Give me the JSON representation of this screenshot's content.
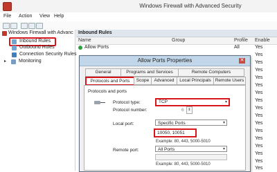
{
  "window": {
    "title": "Windows Firewall with Advanced Security"
  },
  "menu": [
    "File",
    "Action",
    "View",
    "Help"
  ],
  "tree": {
    "root": "Windows Firewall with Advanc",
    "items": [
      "Inbound Rules",
      "Outbound Rules",
      "Connection Security Rules",
      "Monitoring"
    ]
  },
  "pane": {
    "header": "Inbound Rules",
    "columns": {
      "name": "Name",
      "group": "Group",
      "profile": "Profile",
      "enabled": "Enable"
    },
    "first_row": {
      "name": "Allow Ports",
      "profile": "All",
      "enabled": "Yes"
    },
    "enabled_values": [
      "Yes",
      "Yes",
      "Yes",
      "Yes",
      "Yes",
      "Yes",
      "Yes",
      "Yes",
      "Yes",
      "Yes",
      "Yes",
      "Yes",
      "Yes",
      "Yes",
      "Yes",
      "Yes",
      "Yes"
    ]
  },
  "dialog": {
    "title": "Allow Ports Properties",
    "close": "✕",
    "tabs_top": [
      "General",
      "Programs and Services",
      "Remote Computers"
    ],
    "tabs_bottom": [
      "Protocols and Ports",
      "Scope",
      "Advanced",
      "Local Principals",
      "Remote Users"
    ],
    "section": "Protocols and ports",
    "protocol_type_label": "Protocol type:",
    "protocol_type_value": "TCP",
    "protocol_number_label": "Protocol number:",
    "protocol_number_value": "6",
    "local_port_label": "Local port:",
    "local_port_mode": "Specific Ports",
    "local_port_value": "10050, 10051",
    "local_example": "Example: 80, 443, 5000-5010",
    "remote_port_label": "Remote port:",
    "remote_port_mode": "All Ports",
    "remote_example": "Example: 80, 443, 5000-5010"
  },
  "colors": {
    "highlight": "#d9151c",
    "dialog_title": "#c2d6ea",
    "pane_header": "#dfe6ee"
  }
}
